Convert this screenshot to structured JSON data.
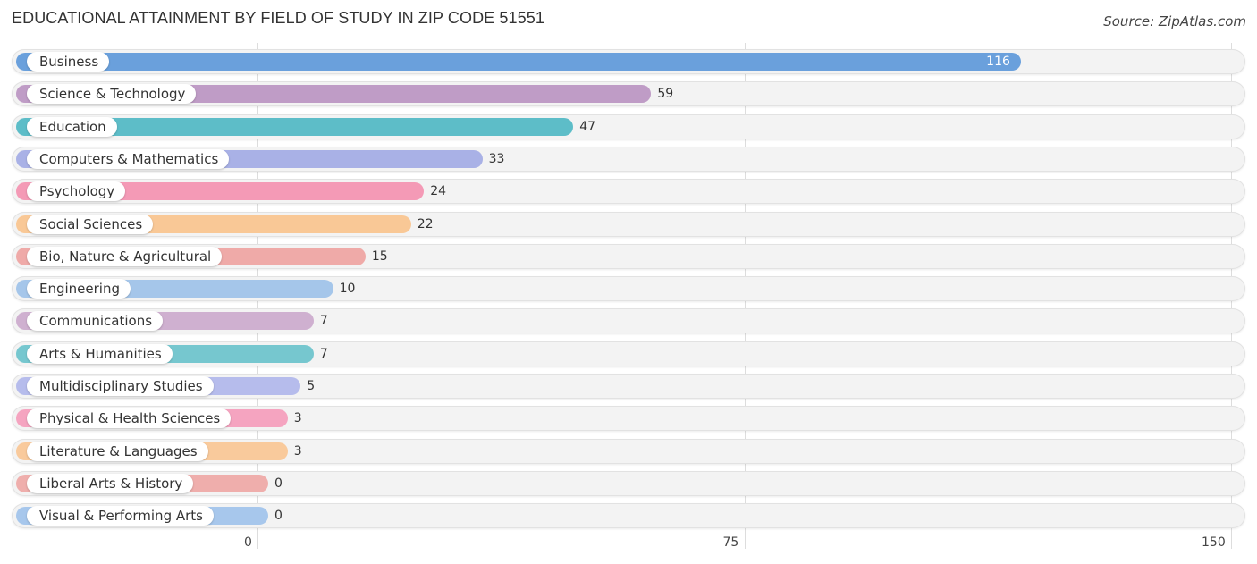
{
  "chart_data": {
    "type": "bar",
    "orientation": "horizontal",
    "title": "EDUCATIONAL ATTAINMENT BY FIELD OF STUDY IN ZIP CODE 51551",
    "source": "Source: ZipAtlas.com",
    "xlabel": "",
    "ylabel": "",
    "xlim": [
      0,
      150
    ],
    "xticks": [
      0,
      75,
      150
    ],
    "xtick_labels": [
      "0",
      "75",
      "150"
    ],
    "grid": true,
    "categories": [
      "Business",
      "Science & Technology",
      "Education",
      "Computers & Mathematics",
      "Psychology",
      "Social Sciences",
      "Bio, Nature & Agricultural",
      "Engineering",
      "Communications",
      "Arts & Humanities",
      "Multidisciplinary Studies",
      "Physical & Health Sciences",
      "Literature & Languages",
      "Liberal Arts & History",
      "Visual & Performing Arts"
    ],
    "values": [
      116,
      59,
      47,
      33,
      24,
      22,
      15,
      10,
      7,
      7,
      5,
      3,
      3,
      0,
      0
    ],
    "value_labels": [
      "116",
      "59",
      "47",
      "33",
      "24",
      "22",
      "15",
      "10",
      "7",
      "7",
      "5",
      "3",
      "3",
      "0",
      "0"
    ],
    "colors": [
      "#6aa0dc",
      "#bf9cc6",
      "#5dbdc8",
      "#a9b1e6",
      "#f49ab6",
      "#f9c896",
      "#efaaa8",
      "#a5c6ea",
      "#cfb0d0",
      "#76c7cf",
      "#b6bcec",
      "#f5a4c0",
      "#f9ca9c",
      "#efaeac",
      "#a7c7ec"
    ]
  }
}
